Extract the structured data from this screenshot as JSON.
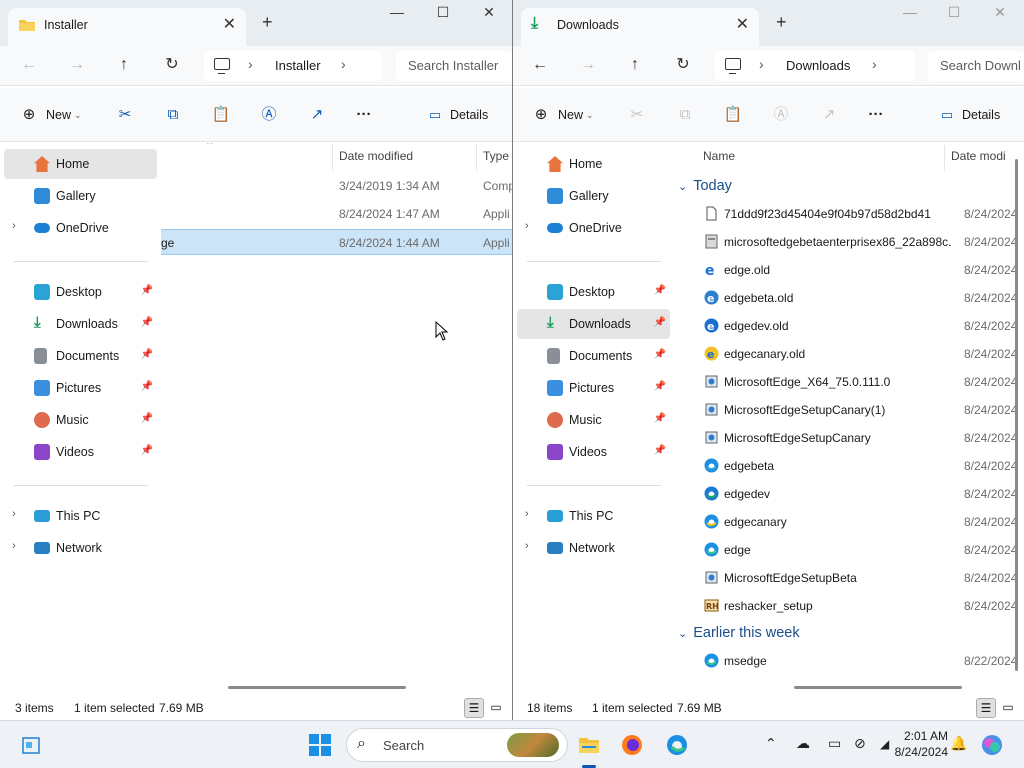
{
  "left": {
    "tab_title": "Installer",
    "breadcrumb": "Installer",
    "search_placeholder": "Search Installer",
    "toolbar": {
      "new_label": "New",
      "details_label": "Details"
    },
    "sidebar": {
      "home": "Home",
      "gallery": "Gallery",
      "onedrive": "OneDrive",
      "desktop": "Desktop",
      "downloads": "Downloads",
      "documents": "Documents",
      "pictures": "Pictures",
      "music": "Music",
      "videos": "Videos",
      "thispc": "This PC",
      "network": "Network"
    },
    "columns": {
      "date": "Date modified",
      "type": "Type"
    },
    "rows": [
      {
        "name": "",
        "date": "3/24/2019 1:34 AM",
        "type": "Comp"
      },
      {
        "name": "",
        "date": "8/24/2024 1:47 AM",
        "type": "Appli"
      },
      {
        "name": "ge",
        "date": "8/24/2024 1:44 AM",
        "type": "Appli"
      }
    ],
    "status": {
      "items": "3 items",
      "selected": "1 item selected",
      "size": "7.69 MB"
    }
  },
  "right": {
    "tab_title": "Downloads",
    "breadcrumb": "Downloads",
    "search_placeholder": "Search Downl",
    "toolbar": {
      "new_label": "New",
      "details_label": "Details"
    },
    "sidebar": {
      "home": "Home",
      "gallery": "Gallery",
      "onedrive": "OneDrive",
      "desktop": "Desktop",
      "downloads": "Downloads",
      "documents": "Documents",
      "pictures": "Pictures",
      "music": "Music",
      "videos": "Videos",
      "thispc": "This PC",
      "network": "Network"
    },
    "columns": {
      "name": "Name",
      "date": "Date modi"
    },
    "group_today": "Today",
    "group_week": "Earlier this week",
    "rows": [
      {
        "name": "71ddd9f23d45404e9f04b97d58d2bd41",
        "date": "8/24/2024",
        "icon": "file"
      },
      {
        "name": "microsoftedgebetaenterprisex86_22a898c...",
        "date": "8/24/2024",
        "icon": "msi"
      },
      {
        "name": "edge.old",
        "date": "8/24/2024",
        "icon": "edge-old"
      },
      {
        "name": "edgebeta.old",
        "date": "8/24/2024",
        "icon": "edge-beta-old"
      },
      {
        "name": "edgedev.old",
        "date": "8/24/2024",
        "icon": "edge-dev-old"
      },
      {
        "name": "edgecanary.old",
        "date": "8/24/2024",
        "icon": "edge-canary-old"
      },
      {
        "name": "MicrosoftEdge_X64_75.0.111.0",
        "date": "8/24/2024",
        "icon": "setup"
      },
      {
        "name": "MicrosoftEdgeSetupCanary(1)",
        "date": "8/24/2024",
        "icon": "setup"
      },
      {
        "name": "MicrosoftEdgeSetupCanary",
        "date": "8/24/2024",
        "icon": "setup"
      },
      {
        "name": "edgebeta",
        "date": "8/24/2024",
        "icon": "edge-beta"
      },
      {
        "name": "edgedev",
        "date": "8/24/2024",
        "icon": "edge-dev"
      },
      {
        "name": "edgecanary",
        "date": "8/24/2024",
        "icon": "edge-canary"
      },
      {
        "name": "edge",
        "date": "8/24/2024",
        "icon": "edge"
      },
      {
        "name": "MicrosoftEdgeSetupBeta",
        "date": "8/24/2024",
        "icon": "setup"
      },
      {
        "name": "reshacker_setup",
        "date": "8/24/2024",
        "icon": "reshacker"
      }
    ],
    "rows_week": [
      {
        "name": "msedge",
        "date": "8/22/2024",
        "icon": "edge"
      }
    ],
    "status": {
      "items": "18 items",
      "selected": "1 item selected",
      "size": "7.69 MB"
    }
  },
  "taskbar": {
    "search_label": "Search",
    "time": "2:01 AM",
    "date": "8/24/2024",
    "icons": [
      "widgets-icon",
      "start-icon",
      "search-icon",
      "file-explorer-icon",
      "firefox-icon",
      "edge-icon"
    ]
  },
  "colors": {
    "accent": "#0b57b3",
    "selection": "#cce4f7",
    "folder": "#f3c23c"
  }
}
